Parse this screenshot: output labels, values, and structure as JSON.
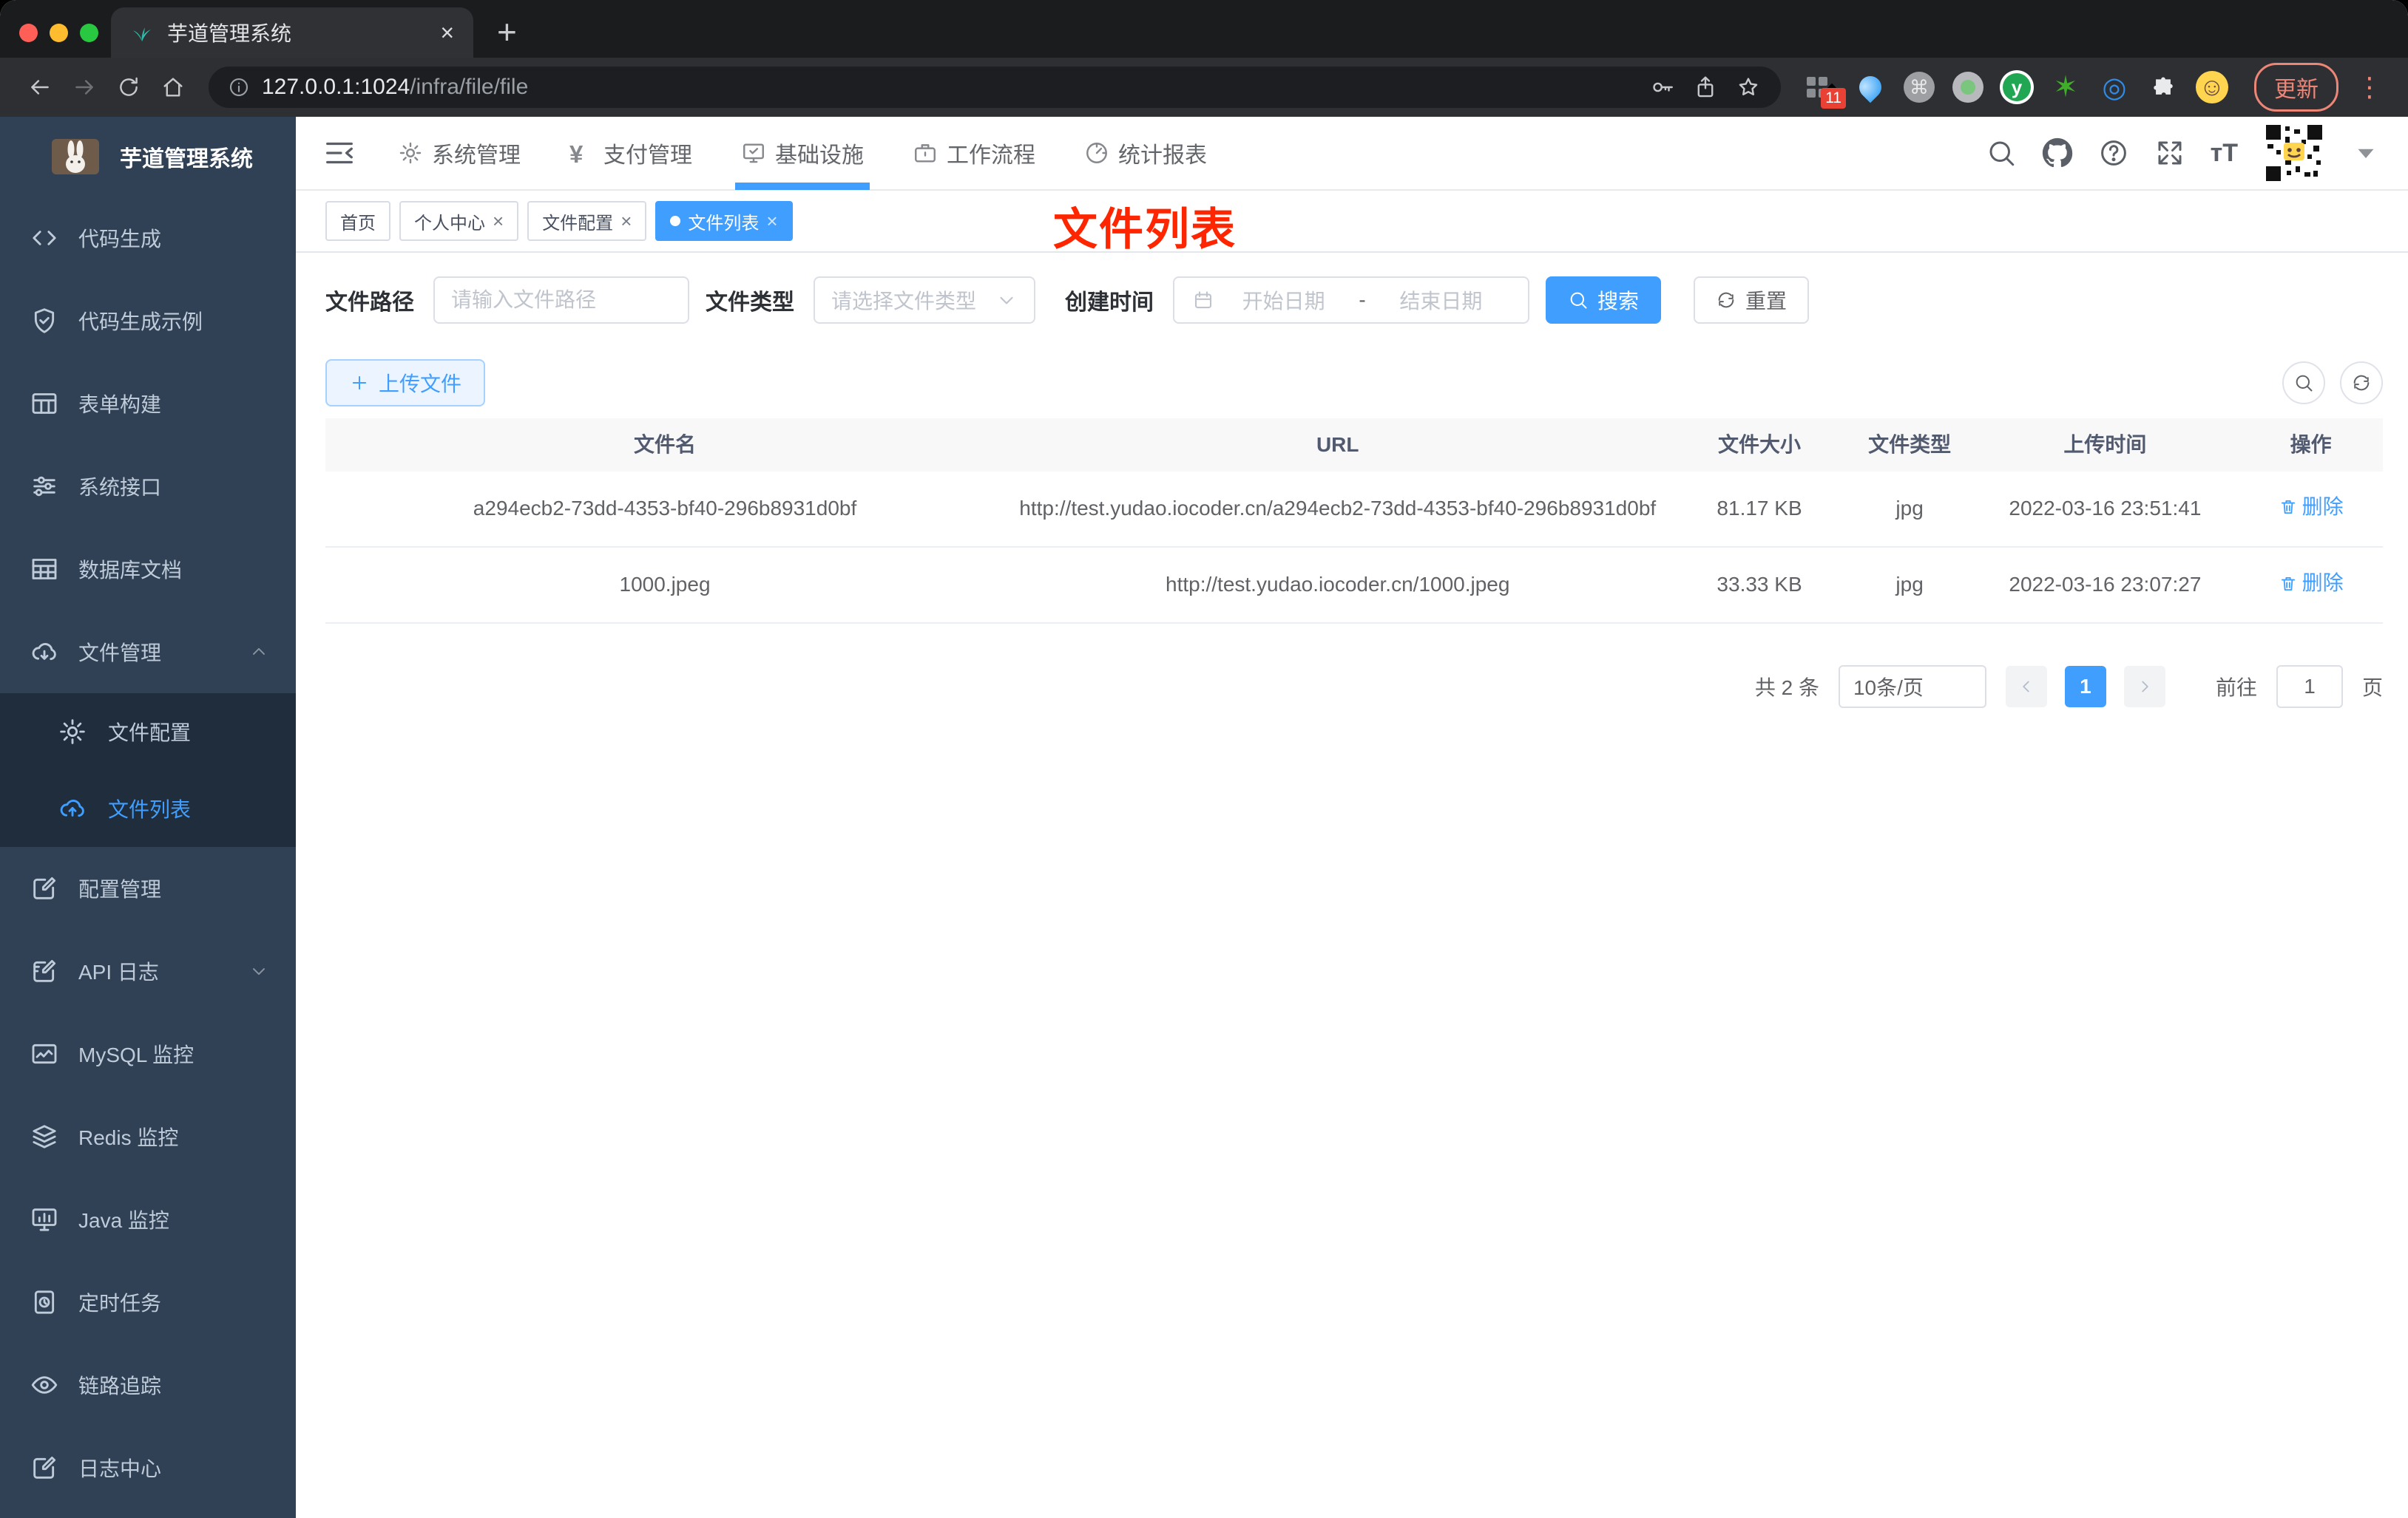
{
  "browser": {
    "tab": {
      "title": "芋道管理系统",
      "close": "×",
      "new_tab": "+"
    },
    "url": {
      "host": "127.0.0.1:1024",
      "path": "/infra/file/file"
    },
    "update_button": "更新",
    "extensions": [
      {
        "name": "grid-diamond-extension",
        "badge": "11"
      },
      {
        "name": "pin-extension"
      },
      {
        "name": "command-extension",
        "glyph": "⌘"
      },
      {
        "name": "green-dot-extension"
      },
      {
        "name": "y-circle-extension",
        "glyph": "y"
      },
      {
        "name": "green-star-extension",
        "glyph": "✶"
      },
      {
        "name": "blue-eye-extension",
        "glyph": "◎"
      },
      {
        "name": "puzzle-extension"
      },
      {
        "name": "emoji-extension",
        "glyph": "☺"
      }
    ]
  },
  "sidebar": {
    "logo_title": "芋道管理系统",
    "items": [
      {
        "icon": "code",
        "label": "代码生成"
      },
      {
        "icon": "shield",
        "label": "代码生成示例"
      },
      {
        "icon": "form",
        "label": "表单构建"
      },
      {
        "icon": "sliders",
        "label": "系统接口"
      },
      {
        "icon": "grid",
        "label": "数据库文档"
      },
      {
        "icon": "cloud-down",
        "label": "文件管理",
        "expanded": true,
        "children": [
          {
            "icon": "gear",
            "label": "文件配置"
          },
          {
            "icon": "cloud-up",
            "label": "文件列表",
            "active": true
          }
        ]
      },
      {
        "icon": "edit",
        "label": "配置管理"
      },
      {
        "icon": "edit-note",
        "label": "API 日志",
        "collapsible": true
      },
      {
        "icon": "chart",
        "label": "MySQL 监控"
      },
      {
        "icon": "layers",
        "label": "Redis 监控"
      },
      {
        "icon": "monitor",
        "label": "Java 监控"
      },
      {
        "icon": "timer",
        "label": "定时任务"
      },
      {
        "icon": "eye",
        "label": "链路追踪"
      },
      {
        "icon": "edit",
        "label": "日志中心"
      }
    ]
  },
  "top_nav": {
    "items": [
      {
        "icon": "gear",
        "label": "系统管理"
      },
      {
        "icon": "yen",
        "label": "支付管理"
      },
      {
        "icon": "monitor-check",
        "label": "基础设施",
        "active": true
      },
      {
        "icon": "briefcase",
        "label": "工作流程"
      },
      {
        "icon": "gauge",
        "label": "统计报表"
      }
    ]
  },
  "tags": [
    {
      "label": "首页",
      "closable": false
    },
    {
      "label": "个人中心",
      "closable": true
    },
    {
      "label": "文件配置",
      "closable": true
    },
    {
      "label": "文件列表",
      "closable": true,
      "active": true
    }
  ],
  "annotation": "文件列表",
  "filters": {
    "path_label": "文件路径",
    "path_placeholder": "请输入文件路径",
    "type_label": "文件类型",
    "type_placeholder": "请选择文件类型",
    "date_label": "创建时间",
    "date_start": "开始日期",
    "date_sep": "-",
    "date_end": "结束日期",
    "search": "搜索",
    "reset": "重置"
  },
  "toolbar": {
    "upload": "上传文件"
  },
  "table": {
    "headers": [
      "文件名",
      "URL",
      "文件大小",
      "文件类型",
      "上传时间",
      "操作"
    ],
    "rows": [
      {
        "name": "a294ecb2-73dd-4353-bf40-296b8931d0bf",
        "url": "http://test.yudao.iocoder.cn/a294ecb2-73dd-4353-bf40-296b8931d0bf",
        "size": "81.17 KB",
        "type": "jpg",
        "time": "2022-03-16 23:51:41",
        "action": "删除"
      },
      {
        "name": "1000.jpeg",
        "url": "http://test.yudao.iocoder.cn/1000.jpeg",
        "size": "33.33 KB",
        "type": "jpg",
        "time": "2022-03-16 23:07:27",
        "action": "删除"
      }
    ]
  },
  "pagination": {
    "total": "共 2 条",
    "page_size": "10条/页",
    "current": "1",
    "goto_label": "前往",
    "goto_value": "1",
    "unit": "页"
  },
  "colors": {
    "accent": "#409eff",
    "sidebar_bg": "#304156",
    "sidebar_sub_bg": "#1f2d3d",
    "annotation_red": "#fe2600"
  }
}
